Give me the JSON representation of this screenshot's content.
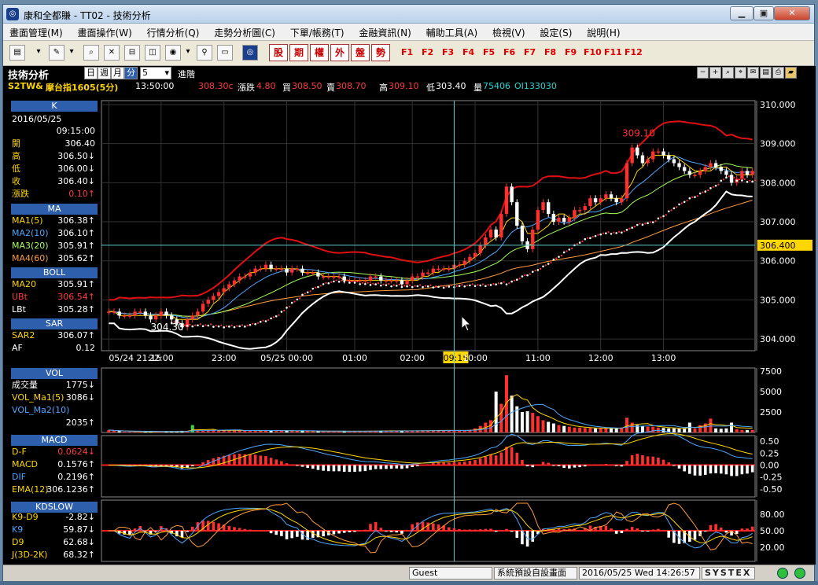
{
  "window": {
    "title": "康和全都賺 - TT02 - 技術分析"
  },
  "menu": [
    "畫面管理(M)",
    "畫面操作(W)",
    "行情分析(Q)",
    "走勢分析圖(C)",
    "下單/帳務(T)",
    "金融資訊(N)",
    "輔助工具(A)",
    "檢視(V)",
    "設定(S)",
    "說明(H)"
  ],
  "toolbar": {
    "quick_buttons": [
      "股",
      "期",
      "權",
      "外",
      "盤",
      "勢"
    ],
    "fkeys": [
      "F1",
      "F2",
      "F3",
      "F4",
      "F5",
      "F6",
      "F7",
      "F8",
      "F9",
      "F10",
      "F11",
      "F12"
    ]
  },
  "controls": {
    "panel_title": "技術分析",
    "periods": [
      "日",
      "週",
      "月",
      "分"
    ],
    "active_period": "分",
    "interval": "5",
    "advanced": "進階"
  },
  "quote": {
    "symbol": "S2TW&",
    "name": "摩台指1605(5分)",
    "time": "13:50:00",
    "price": "308.30c",
    "change_label": "漲跌",
    "change": "4.80",
    "bid_label": "買",
    "bid": "308.50",
    "ask_label": "賣",
    "ask": "308.70",
    "high_label": "高",
    "high": "309.10",
    "low_label": "低",
    "low": "303.40",
    "vol_label": "量",
    "vol": "75406",
    "oi": "OI133030"
  },
  "panel": {
    "k": {
      "title": "K",
      "date": "2016/05/25",
      "time": "09:15:00",
      "rows": [
        {
          "k": "開",
          "v": "306.40"
        },
        {
          "k": "高",
          "v": "306.50↓"
        },
        {
          "k": "低",
          "v": "306.00↓"
        },
        {
          "k": "收",
          "v": "306.40↓"
        },
        {
          "k": "漲跌",
          "v": "0.10↑"
        }
      ]
    },
    "ma": {
      "title": "MA",
      "rows": [
        {
          "k": "MA1(5)",
          "v": "306.38↑"
        },
        {
          "k": "MA2(10)",
          "v": "306.10↑"
        },
        {
          "k": "MA3(20)",
          "v": "305.91↑"
        },
        {
          "k": "MA4(60)",
          "v": "305.62↑"
        }
      ]
    },
    "boll": {
      "title": "BOLL",
      "rows": [
        {
          "k": "MA20",
          "v": "305.91↑"
        },
        {
          "k": "UBt",
          "v": "306.54↑"
        },
        {
          "k": "LBt",
          "v": "305.28↑"
        }
      ]
    },
    "sar": {
      "title": "SAR",
      "rows": [
        {
          "k": "SAR2",
          "v": "306.07↑"
        },
        {
          "k": "AF",
          "v": "0.12"
        }
      ]
    },
    "vol": {
      "title": "VOL",
      "rows": [
        {
          "k": "成交量",
          "v": "1775↓"
        },
        {
          "k": "VOL_Ma1(5)",
          "v": "3086↓"
        },
        {
          "k": "VOL_Ma2(10)",
          "v": ""
        },
        {
          "k": "",
          "v": "2035↑"
        }
      ]
    },
    "macd": {
      "title": "MACD",
      "rows": [
        {
          "k": "D-F",
          "v": "0.0624↓"
        },
        {
          "k": "MACD",
          "v": "0.1576↑"
        },
        {
          "k": "DIF",
          "v": "0.2196↑"
        },
        {
          "k": "EMA(12)",
          "v": "306.1236↑"
        }
      ]
    },
    "kd": {
      "title": "KDSLOW",
      "rows": [
        {
          "k": "K9-D9",
          "v": "-2.82↓"
        },
        {
          "k": "K9",
          "v": "59.87↓"
        },
        {
          "k": "D9",
          "v": "62.68↓"
        },
        {
          "k": "J(3D-2K)",
          "v": "68.32↑"
        }
      ]
    }
  },
  "chart_data": [
    {
      "type": "candlestick",
      "y_ticks": [
        "310.000",
        "309.000",
        "308.000",
        "307.000",
        "306.000",
        "305.000",
        "304.000"
      ],
      "ylim": [
        303.7,
        310.1
      ],
      "x_ticks": [
        "05/24 21:15",
        "22:00",
        "23:00",
        "05/25 00:00",
        "01:00",
        "02:00",
        "09:15",
        "10:00",
        "11:00",
        "12:00",
        "13:00"
      ],
      "cursor_label": "09:15",
      "price_tag": "306.400",
      "annotations": [
        {
          "text": "309.10"
        },
        {
          "text": "304.30"
        }
      ],
      "close": [
        304.7,
        304.7,
        304.6,
        304.6,
        304.6,
        304.7,
        304.7,
        304.6,
        304.5,
        304.6,
        304.7,
        304.6,
        304.5,
        304.4,
        304.3,
        304.5,
        304.6,
        304.7,
        304.9,
        305.0,
        305.1,
        305.2,
        305.3,
        305.4,
        305.5,
        305.6,
        305.6,
        305.7,
        305.8,
        305.8,
        305.9,
        305.8,
        305.8,
        305.8,
        305.7,
        305.8,
        305.8,
        305.7,
        305.7,
        305.7,
        305.6,
        305.6,
        305.6,
        305.6,
        305.6,
        305.5,
        305.5,
        305.5,
        305.5,
        305.5,
        305.6,
        305.6,
        305.5,
        305.5,
        305.5,
        305.5,
        305.4,
        305.5,
        305.6,
        305.6,
        305.7,
        305.7,
        305.8,
        305.8,
        305.8,
        305.8,
        305.9,
        305.9,
        306.0,
        306.1,
        306.2,
        306.4,
        306.6,
        306.8,
        306.6,
        307.2,
        307.9,
        307.5,
        306.9,
        306.5,
        306.3,
        306.8,
        307.3,
        307.5,
        307.2,
        307.0,
        307.1,
        307.0,
        307.1,
        307.3,
        307.3,
        307.4,
        307.6,
        307.5,
        307.6,
        307.7,
        307.6,
        307.5,
        307.6,
        308.5,
        308.9,
        308.7,
        308.5,
        308.6,
        308.8,
        308.8,
        308.7,
        308.6,
        308.5,
        308.4,
        308.3,
        308.2,
        308.2,
        308.3,
        308.4,
        308.5,
        308.4,
        308.3,
        308.2,
        308.0,
        308.1,
        308.3,
        308.2,
        308.3
      ],
      "sma5": [
        304.7,
        304.7,
        304.6,
        304.6,
        304.6,
        304.6,
        304.6,
        304.6,
        304.6,
        304.6,
        304.6,
        304.6,
        304.6,
        304.5,
        304.5,
        304.5,
        304.5,
        304.5,
        304.6,
        304.7,
        304.9,
        305.0,
        305.2,
        305.3,
        305.4,
        305.5,
        305.6,
        305.7,
        305.7,
        305.8,
        305.8,
        305.8,
        305.8,
        305.8,
        305.8,
        305.8,
        305.8,
        305.7,
        305.7,
        305.7,
        305.7,
        305.6,
        305.6,
        305.6,
        305.6,
        305.5,
        305.5,
        305.5,
        305.5,
        305.5,
        305.5,
        305.5,
        305.5,
        305.5,
        305.5,
        305.5,
        305.5,
        305.5,
        305.5,
        305.5,
        305.6,
        305.6,
        305.7,
        305.7,
        305.8,
        305.8,
        305.8,
        305.9,
        305.9,
        306.0,
        306.1,
        306.2,
        306.4,
        306.5,
        306.6,
        306.7,
        307.0,
        307.1,
        307.1,
        307.0,
        306.7,
        306.7,
        306.7,
        306.8,
        306.9,
        307.1,
        307.2,
        307.2,
        307.1,
        307.1,
        307.2,
        307.2,
        307.3,
        307.4,
        307.5,
        307.6,
        307.6,
        307.6,
        307.6,
        307.8,
        308.0,
        308.3,
        308.4,
        308.6,
        308.7,
        308.7,
        308.7,
        308.7,
        308.7,
        308.6,
        308.5,
        308.4,
        308.3,
        308.3,
        308.3,
        308.3,
        308.4,
        308.4,
        308.4,
        308.3,
        308.2,
        308.2,
        308.2,
        308.2
      ]
    },
    {
      "type": "bar",
      "title": "VOL",
      "y_ticks": [
        "7500",
        "5000",
        "2500"
      ],
      "ylim": [
        0,
        7500
      ],
      "values": [
        300,
        200,
        150,
        120,
        100,
        100,
        100,
        100,
        100,
        150,
        150,
        100,
        100,
        100,
        200,
        200,
        900,
        250,
        200,
        250,
        300,
        250,
        200,
        250,
        300,
        250,
        200,
        200,
        250,
        200,
        300,
        250,
        200,
        200,
        200,
        200,
        200,
        200,
        150,
        150,
        150,
        150,
        150,
        150,
        150,
        150,
        150,
        150,
        150,
        150,
        200,
        200,
        200,
        200,
        200,
        200,
        200,
        200,
        200,
        200,
        250,
        250,
        250,
        250,
        250,
        250,
        250,
        250,
        250,
        300,
        500,
        800,
        1200,
        1500,
        5000,
        3500,
        7000,
        4500,
        3200,
        2500,
        2600,
        2400,
        2000,
        1500,
        1300,
        1100,
        900,
        800,
        700,
        600,
        600,
        550,
        550,
        500,
        500,
        500,
        500,
        500,
        600,
        1800,
        1200,
        900,
        800,
        700,
        700,
        600,
        550,
        500,
        500,
        450,
        450,
        1200,
        500,
        900,
        1100,
        1700,
        500,
        450,
        500,
        1200,
        400,
        300,
        300,
        300
      ]
    },
    {
      "type": "bar",
      "title": "MACD",
      "y_ticks": [
        "0.50",
        "0.25",
        "0.00",
        "-0.25",
        "-0.50"
      ],
      "ylim": [
        -0.6,
        0.55
      ]
    },
    {
      "type": "bar",
      "title": "KDSLOW",
      "y_ticks": [
        "80.00",
        "50.00",
        "20.00"
      ],
      "ylim": [
        0,
        100
      ]
    }
  ],
  "status": {
    "user": "Guest",
    "layout": "系統預設自設畫面",
    "datetime": "2016/05/25 Wed 14:26:57",
    "brand": "SYSTEX"
  }
}
